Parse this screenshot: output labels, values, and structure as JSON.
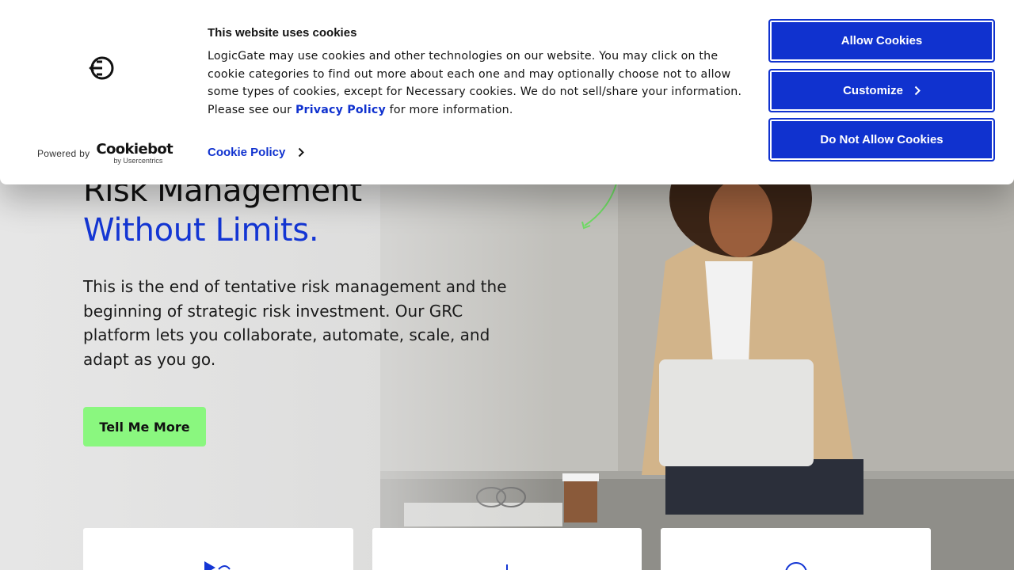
{
  "hero": {
    "title_line1": "Risk Management",
    "title_line2": "Without Limits.",
    "description": "This is the end of tentative risk management and the beginning of strategic risk investment. Our GRC platform lets you collaborate, automate, scale, and adapt as you go.",
    "cta_label": "Tell Me More"
  },
  "cookie_banner": {
    "title": "This website uses cookies",
    "text_before_link": "LogicGate may use cookies and other technologies on our website. You may click on the cookie categories to find out more about each one and may optionally choose not to allow some types of cookies, except for Necessary cookies.  We do not sell/share your information. Please see our ",
    "privacy_link": "Privacy Policy",
    "text_after_link": " for more information.",
    "cookie_policy_link": "Cookie Policy",
    "powered_by": "Powered by",
    "brand_name": "Cookiebot",
    "brand_sub": "by Usercentrics",
    "buttons": {
      "allow": "Allow Cookies",
      "customize": "Customize",
      "deny": "Do Not Allow Cookies"
    },
    "icons": {
      "logo": "logicgate-logo-icon",
      "chevron": "chevron-right-icon"
    }
  },
  "colors": {
    "accent_blue": "#1032cf",
    "cta_green": "#8af77f",
    "headline_blue": "#1436d4"
  }
}
